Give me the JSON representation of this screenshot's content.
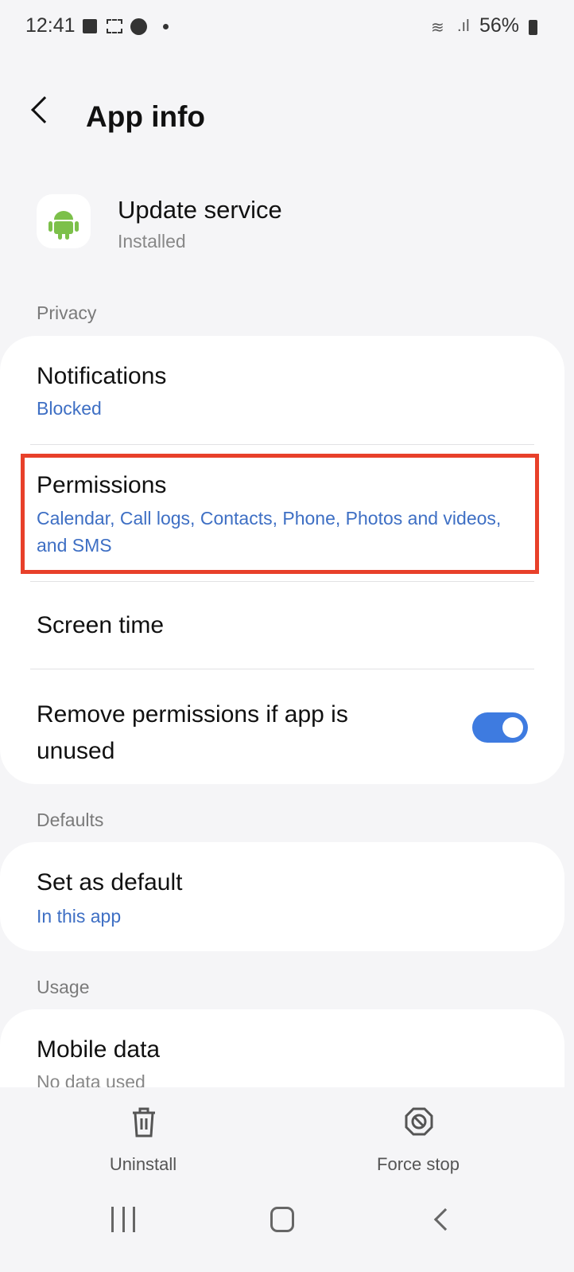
{
  "status_bar": {
    "time": "12:41",
    "battery": "56%",
    "icons": [
      "image-icon",
      "screenshot-icon",
      "account-icon",
      "dot-icon",
      "wifi-icon",
      "signal-icon",
      "battery-icon"
    ]
  },
  "header": {
    "title": "App info",
    "back_icon": "chevron-left-icon"
  },
  "app": {
    "name": "Update service",
    "status": "Installed",
    "icon": "android-icon",
    "icon_color": "#7cc04a"
  },
  "sections": {
    "privacy": {
      "label": "Privacy",
      "notifications": {
        "title": "Notifications",
        "value": "Blocked"
      },
      "permissions": {
        "title": "Permissions",
        "value": "Calendar, Call logs, Contacts, Phone, Photos and videos, and SMS"
      },
      "screen_time": {
        "title": "Screen time"
      },
      "remove_permissions": {
        "title": "Remove permissions if app is unused",
        "toggle_on": true
      }
    },
    "defaults": {
      "label": "Defaults",
      "set_default": {
        "title": "Set as default",
        "value": "In this app"
      }
    },
    "usage": {
      "label": "Usage",
      "mobile_data": {
        "title": "Mobile data",
        "value": "No data used"
      }
    }
  },
  "actions": {
    "uninstall": "Uninstall",
    "force_stop": "Force stop"
  },
  "colors": {
    "accent": "#3e6fc4",
    "highlight": "#e8402a",
    "toggle": "#3e7be0"
  }
}
